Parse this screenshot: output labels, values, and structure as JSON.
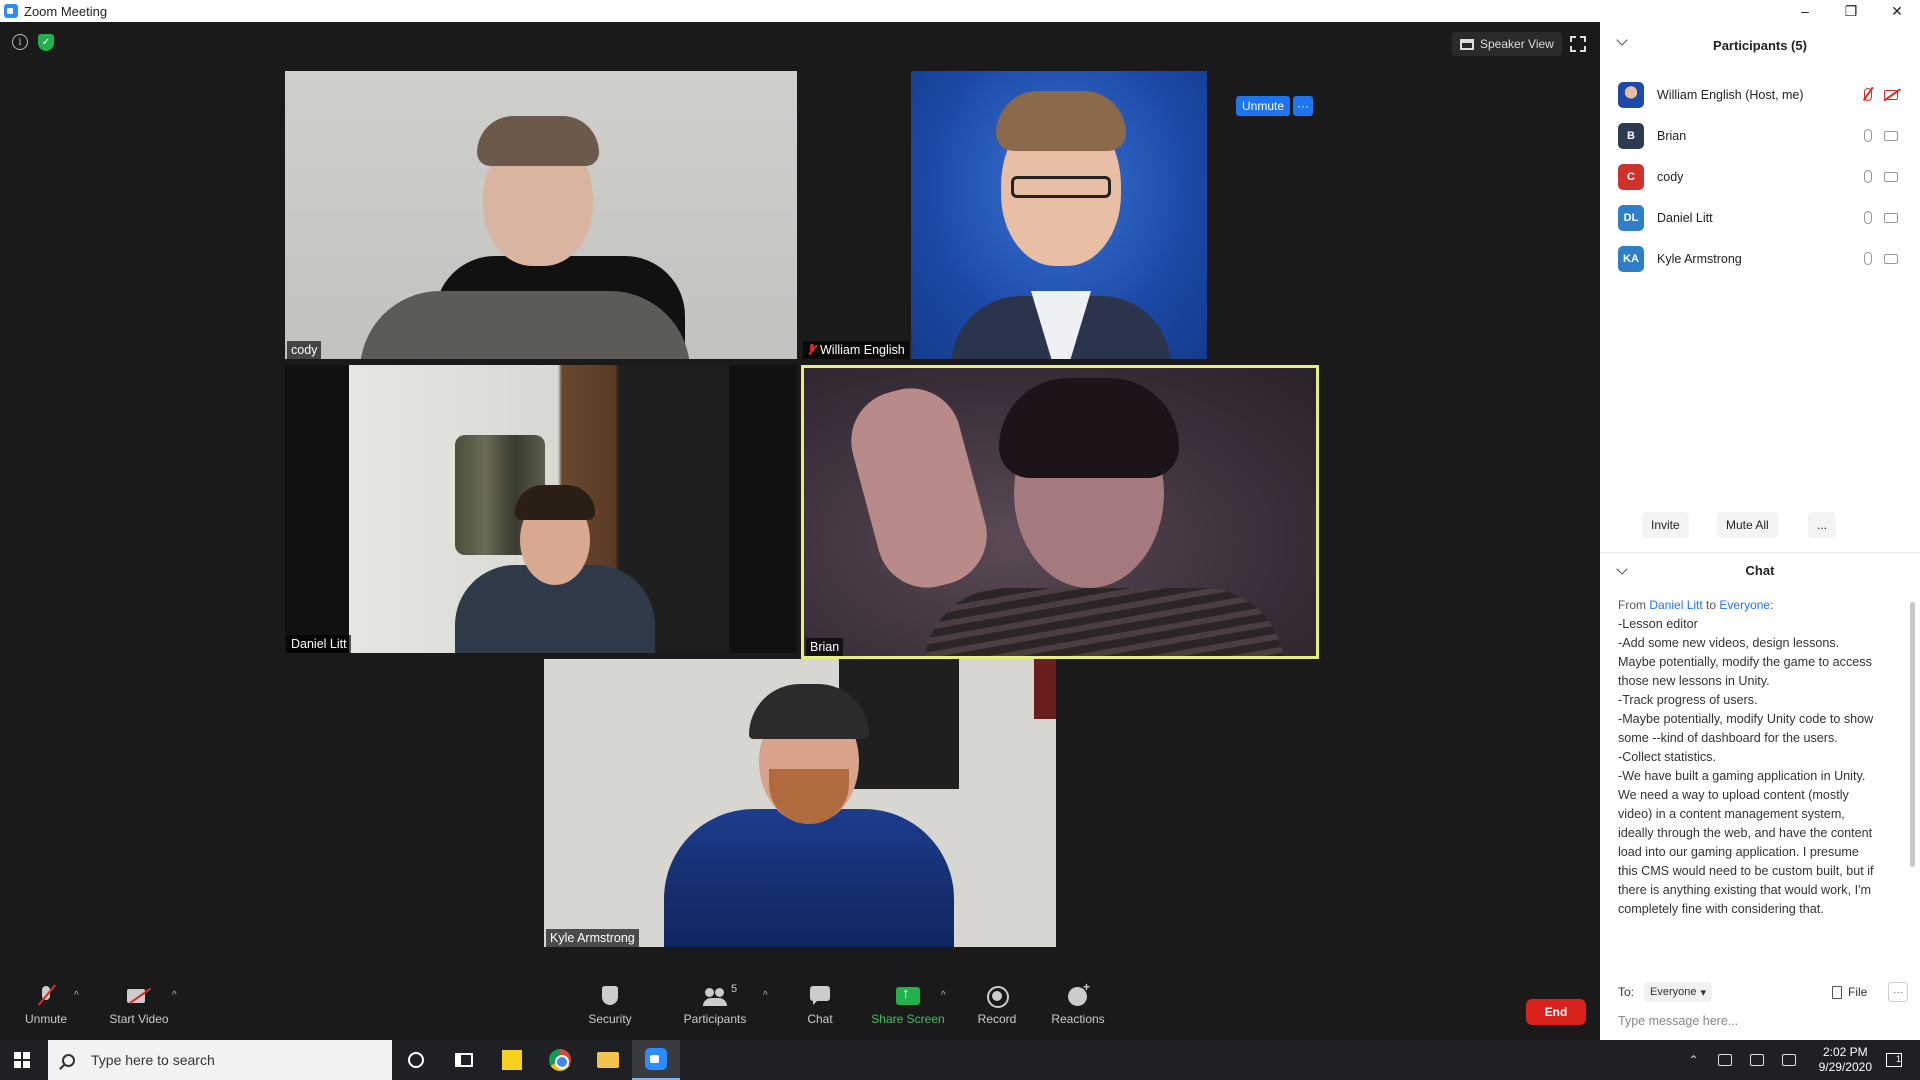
{
  "window": {
    "title": "Zoom Meeting"
  },
  "top_bar": {
    "speaker_view_label": "Speaker View"
  },
  "tiles": {
    "cody": {
      "name": "cody"
    },
    "william": {
      "name": "William English",
      "unmute_label": "Unmute",
      "more_label": "···"
    },
    "daniel": {
      "name": "Daniel Litt"
    },
    "brian": {
      "name": "Brian"
    },
    "kyle": {
      "name": "Kyle Armstrong"
    }
  },
  "toolbar": {
    "unmute_label": "Unmute",
    "start_video_label": "Start Video",
    "security_label": "Security",
    "participants_label": "Participants",
    "participants_count": "5",
    "chat_label": "Chat",
    "share_screen_label": "Share Screen",
    "record_label": "Record",
    "reactions_label": "Reactions",
    "end_label": "End",
    "caret": "^"
  },
  "participants_panel": {
    "title": "Participants (5)",
    "items": [
      {
        "name": "William English (Host, me)",
        "avatar": "",
        "color": "#1d4aa8",
        "mic": "muted",
        "video": "off"
      },
      {
        "name": "Brian",
        "avatar": "B",
        "color": "#2d3a4f",
        "mic": "on",
        "video": "on"
      },
      {
        "name": "cody",
        "avatar": "C",
        "color": "#d0312d",
        "mic": "on",
        "video": "on"
      },
      {
        "name": "Daniel Litt",
        "avatar": "DL",
        "color": "#2f7fc8",
        "mic": "on",
        "video": "on"
      },
      {
        "name": "Kyle Armstrong",
        "avatar": "KA",
        "color": "#2f7fc8",
        "mic": "on",
        "video": "on"
      }
    ],
    "invite_label": "Invite",
    "mute_all_label": "Mute All",
    "more_label": "..."
  },
  "chat_panel": {
    "title": "Chat",
    "from_prefix": "From ",
    "from_name": "Daniel Litt",
    "to_word": " to ",
    "to_name": "Everyone",
    "to_suffix": ":",
    "lines": [
      "-Lesson editor",
      "-Add some new videos, design lessons. Maybe potentially, modify the game to access those new lessons in Unity.",
      "-Track progress of users.",
      "-Maybe potentially, modify Unity code to show some --kind of dashboard for the users.",
      "-Collect statistics.",
      "-We have built a gaming application in Unity. We need a way to upload content (mostly video) in a content management system, ideally through the web, and have the content load into our gaming application. I presume this CMS would need to be custom built, but if there is anything existing that would work, I'm completely fine with considering that."
    ],
    "to_label": "To:",
    "to_select": "Everyone",
    "file_label": "File",
    "more_label": "···",
    "input_placeholder": "Type message here..."
  },
  "taskbar": {
    "search_placeholder": "Type here to search",
    "time": "2:02 PM",
    "date": "9/29/2020",
    "notification_count": "1"
  }
}
